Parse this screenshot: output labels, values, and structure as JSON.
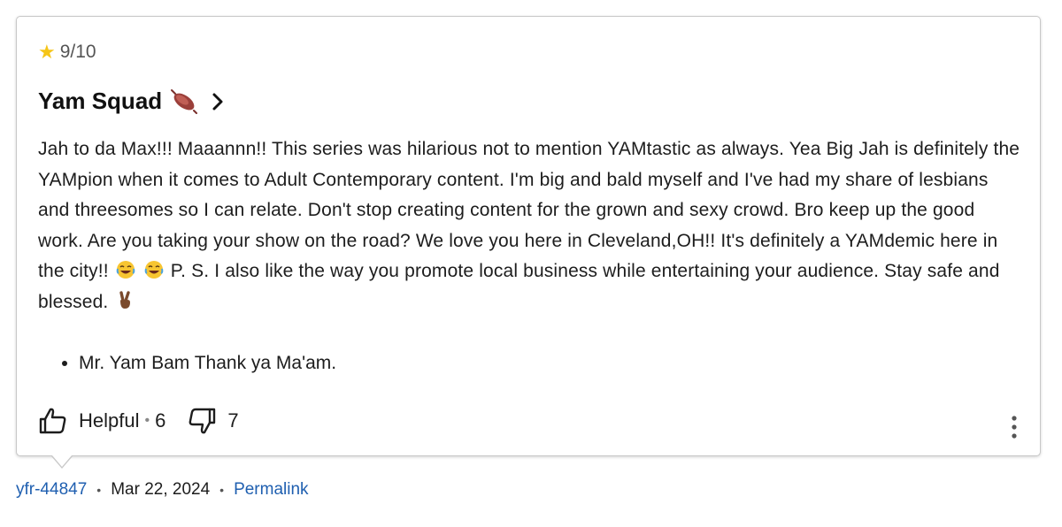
{
  "review": {
    "rating": "9/10",
    "title": "Yam Squad",
    "body": {
      "p1": "Jah to da Max!!! Maaannn!! This series was hilarious not to mention YAMtastic as always. Yea Big Jah is definitely the YAMpion when it comes to Adult Contemporary content. I'm big and bald myself and I've had my share of lesbians and threesomes so I can relate. Don't stop creating content for the grown and sexy crowd. Bro keep up the good work. Are you taking your show on the road? We love you here in Cleveland,OH!! It's definitely a YAMdemic here in the city!!",
      "p2": "P. S. I also like the way you promote local business while entertaining your audience. Stay safe and blessed."
    },
    "bullets": [
      "Mr. Yam Bam Thank ya Ma'am."
    ],
    "helpful_label": "Helpful",
    "helpful_count": "6",
    "not_helpful_count": "7"
  },
  "footer": {
    "author": "yfr-44847",
    "date": "Mar 22, 2024",
    "permalink": "Permalink"
  },
  "colors": {
    "star": "#f5c518",
    "link": "#1f5fb0",
    "border": "#c8c8c8"
  },
  "icons": [
    "star-icon",
    "sweet-potato-icon",
    "chevron-right-icon",
    "laughing-emoji-icon",
    "victory-hand-icon",
    "thumbs-up-icon",
    "thumbs-down-icon",
    "more-vertical-icon"
  ]
}
